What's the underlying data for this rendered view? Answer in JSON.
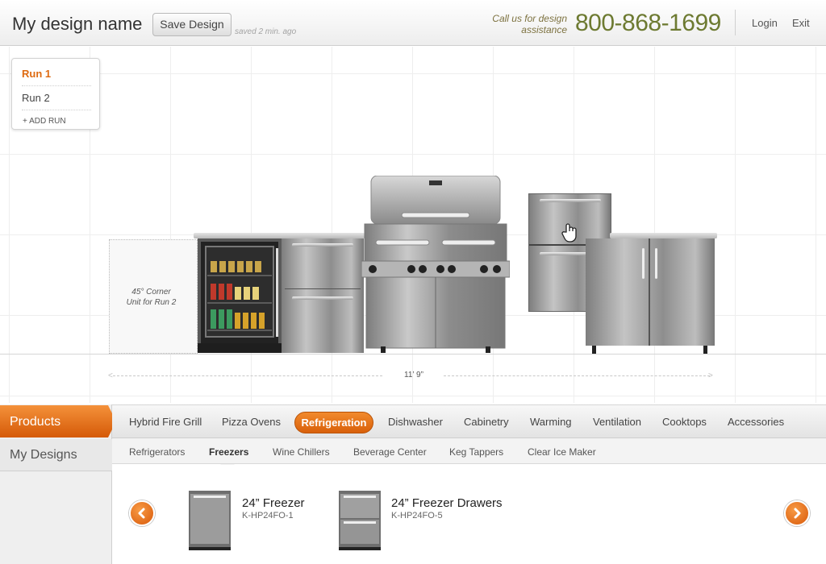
{
  "header": {
    "design_name": "My design name",
    "save_label": "Save Design",
    "saved_status": "saved 2 min. ago",
    "call_us_line1": "Call us for design",
    "call_us_line2": "assistance",
    "phone": "800-868-1699",
    "login_label": "Login",
    "exit_label": "Exit"
  },
  "runs": {
    "items": [
      {
        "label": "Run 1"
      },
      {
        "label": "Run 2"
      }
    ],
    "add_label": "+ ADD RUN"
  },
  "canvas": {
    "corner_label_line1": "45° Corner",
    "corner_label_line2": "Unit for Run 2",
    "dimension": "11’ 9”"
  },
  "nav": {
    "products_label": "Products",
    "my_designs_label": "My Designs"
  },
  "categories": [
    {
      "label": "Hybrid Fire Grill"
    },
    {
      "label": "Pizza Ovens"
    },
    {
      "label": "Refrigeration"
    },
    {
      "label": "Dishwasher"
    },
    {
      "label": "Cabinetry"
    },
    {
      "label": "Warming"
    },
    {
      "label": "Ventilation"
    },
    {
      "label": "Cooktops"
    },
    {
      "label": "Accessories"
    }
  ],
  "subcategories": [
    {
      "label": "Refrigerators"
    },
    {
      "label": "Freezers"
    },
    {
      "label": "Wine Chillers"
    },
    {
      "label": "Beverage Center"
    },
    {
      "label": "Keg Tappers"
    },
    {
      "label": "Clear Ice Maker"
    }
  ],
  "products": [
    {
      "title": "24” Freezer",
      "sku": "K-HP24FO-1"
    },
    {
      "title": "24” Freezer Drawers",
      "sku": "K-HP24FO-5"
    }
  ],
  "colors": {
    "accent_orange": "#e0680f",
    "phone_green": "#6d7a31"
  },
  "icons": [
    "arrow-left-icon",
    "arrow-right-icon",
    "hand-cursor-icon"
  ]
}
